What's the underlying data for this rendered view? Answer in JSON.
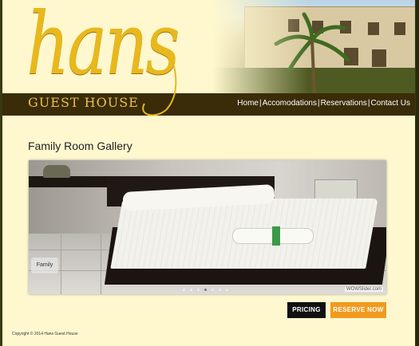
{
  "brand": {
    "name": "hans",
    "tagline": "GUEST HOUSE"
  },
  "nav": {
    "items": [
      "Home",
      "Accomodations",
      "Reservations",
      "Contact Us"
    ],
    "separator": "|"
  },
  "gallery": {
    "title": "Family Room Gallery",
    "caption": "Family",
    "slide_count": 7,
    "active_slide": 4,
    "watermark": "WOWSlider.com"
  },
  "buttons": {
    "pricing": "PRICING",
    "reserve": "RESERVE NOW"
  },
  "footer": {
    "copyright": "Copyright © 2014 Hans Guest House"
  },
  "colors": {
    "page_bg": "#fff8cf",
    "nav_bg": "#3a2c08",
    "logo_gold": "#e8b81c",
    "reserve_orange": "#f29a1f"
  },
  "icons": [
    "slider-dot-icon"
  ]
}
